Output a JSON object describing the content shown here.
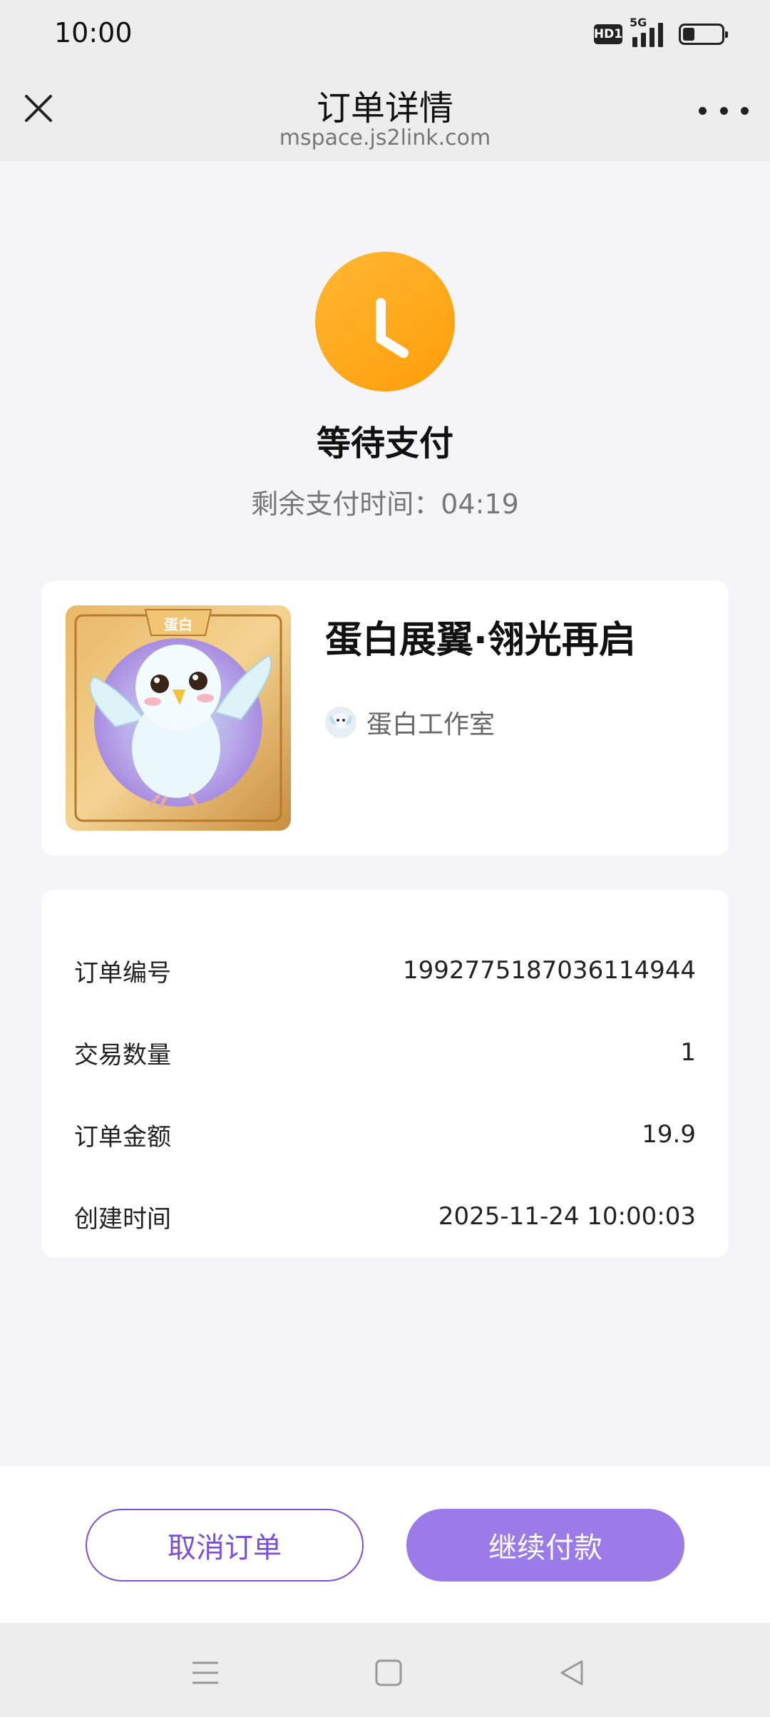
{
  "status_bar": {
    "time": "10:00",
    "hd_label": "HD1",
    "network_label": "5G",
    "battery_level": 0.3
  },
  "nav": {
    "title": "订单详情",
    "subtitle": "mspace.js2link.com",
    "close_icon": "close-icon",
    "more_icon": "more-icon"
  },
  "status": {
    "icon": "clock-icon",
    "icon_color": "#FFA619",
    "title": "等待支付",
    "countdown_label": "剩余支付时间：",
    "countdown_value": "04:19"
  },
  "product": {
    "title": "蛋白展翼·翎光再启",
    "creator": "蛋白工作室",
    "image_badge": "蛋白"
  },
  "order_info": {
    "rows": [
      {
        "label": "订单编号",
        "value": "1992775187036114944"
      },
      {
        "label": "交易数量",
        "value": "1"
      },
      {
        "label": "订单金额",
        "value": "19.9"
      },
      {
        "label": "创建时间",
        "value": "2025-11-24 10:00:03"
      }
    ]
  },
  "actions": {
    "cancel_label": "取消订单",
    "pay_label": "继续付款",
    "accent_color": "#7B4FD6",
    "pay_color": "#9B7BE8"
  },
  "system_nav": {
    "menu_icon": "menu-icon",
    "home_icon": "home-icon",
    "back_icon": "back-icon"
  }
}
